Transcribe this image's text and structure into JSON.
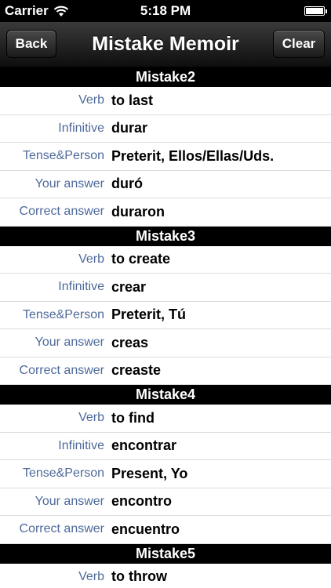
{
  "status": {
    "carrier": "Carrier",
    "time": "5:18 PM"
  },
  "nav": {
    "title": "Mistake Memoir",
    "back_label": "Back",
    "clear_label": "Clear"
  },
  "labels": {
    "verb": "Verb",
    "infinitive": "Infinitive",
    "tense_person": "Tense&Person",
    "your_answer": "Your answer",
    "correct_answer": "Correct answer"
  },
  "mistakes": [
    {
      "title": "Mistake2",
      "verb": "to last",
      "infinitive": "durar",
      "tense_person": "Preterit, Ellos/Ellas/Uds.",
      "your_answer": "duró",
      "correct_answer": "duraron"
    },
    {
      "title": "Mistake3",
      "verb": "to create",
      "infinitive": "crear",
      "tense_person": "Preterit, Tú",
      "your_answer": "creas",
      "correct_answer": "creaste"
    },
    {
      "title": "Mistake4",
      "verb": "to find",
      "infinitive": "encontrar",
      "tense_person": "Present, Yo",
      "your_answer": "encontro",
      "correct_answer": "encuentro"
    },
    {
      "title": "Mistake5",
      "verb": "to throw"
    }
  ]
}
